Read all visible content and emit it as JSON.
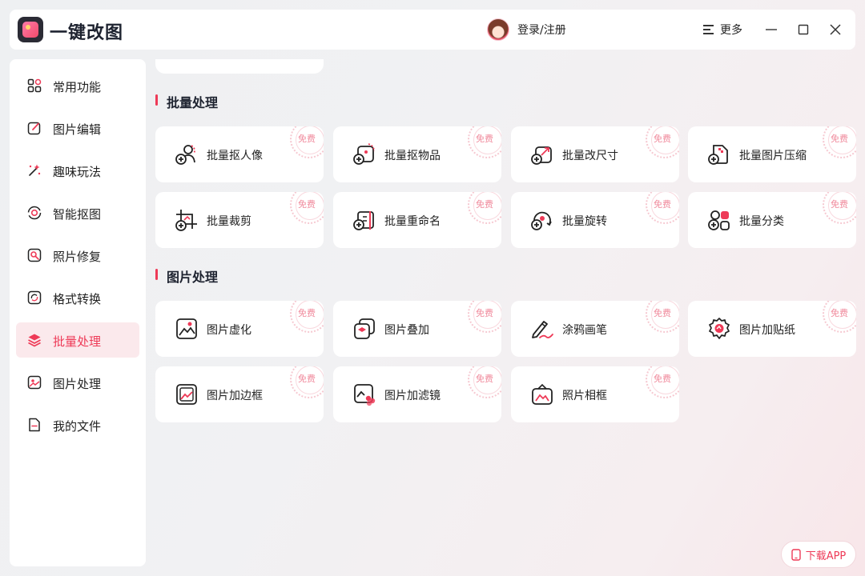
{
  "app": {
    "title": "一键改图",
    "logo_icon": "app-logo-icon"
  },
  "header": {
    "login_label": "登录/注册",
    "more_label": "更多",
    "minimize_icon": "minimize-icon",
    "maximize_icon": "maximize-icon",
    "close_icon": "close-icon"
  },
  "sidebar": {
    "items": [
      {
        "label": "常用功能",
        "icon": "grid-icon"
      },
      {
        "label": "图片编辑",
        "icon": "edit-icon"
      },
      {
        "label": "趣味玩法",
        "icon": "magic-wand-icon"
      },
      {
        "label": "智能抠图",
        "icon": "target-icon"
      },
      {
        "label": "照片修复",
        "icon": "repair-icon"
      },
      {
        "label": "格式转换",
        "icon": "convert-icon"
      },
      {
        "label": "批量处理",
        "icon": "layers-icon",
        "active": true
      },
      {
        "label": "图片处理",
        "icon": "image-icon"
      },
      {
        "label": "我的文件",
        "icon": "file-icon"
      }
    ]
  },
  "sections": [
    {
      "title": "批量处理",
      "cards": [
        {
          "label": "批量抠人像",
          "badge": "免费",
          "icon": "batch-portrait-cutout-icon"
        },
        {
          "label": "批量抠物品",
          "badge": "免费",
          "icon": "batch-object-cutout-icon"
        },
        {
          "label": "批量改尺寸",
          "badge": "免费",
          "icon": "batch-resize-icon"
        },
        {
          "label": "批量图片压缩",
          "badge": "免费",
          "icon": "batch-compress-icon"
        },
        {
          "label": "批量裁剪",
          "badge": "免费",
          "icon": "batch-crop-icon"
        },
        {
          "label": "批量重命名",
          "badge": "免费",
          "icon": "batch-rename-icon"
        },
        {
          "label": "批量旋转",
          "badge": "免费",
          "icon": "batch-rotate-icon"
        },
        {
          "label": "批量分类",
          "badge": "免费",
          "icon": "batch-classify-icon"
        }
      ]
    },
    {
      "title": "图片处理",
      "cards": [
        {
          "label": "图片虚化",
          "badge": "免费",
          "icon": "blur-icon"
        },
        {
          "label": "图片叠加",
          "badge": "免费",
          "icon": "overlay-icon"
        },
        {
          "label": "涂鸦画笔",
          "badge": "免费",
          "icon": "brush-icon"
        },
        {
          "label": "图片加贴纸",
          "badge": "免费",
          "icon": "sticker-icon"
        },
        {
          "label": "图片加边框",
          "badge": "免费",
          "icon": "border-icon"
        },
        {
          "label": "图片加滤镜",
          "badge": "免费",
          "icon": "filter-icon"
        },
        {
          "label": "照片相框",
          "badge": "免费",
          "icon": "photo-frame-icon"
        }
      ]
    }
  ],
  "footer": {
    "download_label": "下载APP",
    "download_icon": "phone-icon"
  },
  "colors": {
    "accent": "#ee3a57",
    "active_bg": "#fbe9ec",
    "badge": "#f08a9c"
  }
}
